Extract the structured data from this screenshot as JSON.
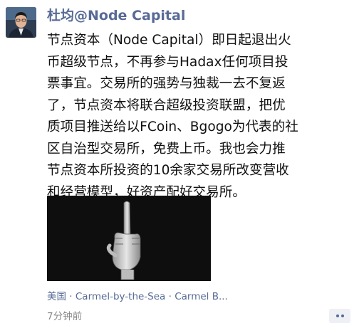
{
  "post": {
    "author": "杜均@Node Capital",
    "text_lines": [
      "节点资本（Node Capital）即日起退出火",
      "币超级节点，不再参与Hadax任何项目投",
      "票事宜。交易所的强势与独裁一去不复返",
      "了，节点资本将联合超级投资联盟，把优",
      "质项目推送给以FCoin、Bgogo为代表的社",
      "区自治型交易所，免费上币。我也会力推",
      "节点资本所投资的10余家交易所改变营收",
      "和经营模型，好资产配好交易所。"
    ],
    "location": "美国 · Carmel-by-the-Sea · Carmel B...",
    "time": "7分钟前"
  },
  "icons": {
    "avatar": "profile-photo",
    "image": "middle-finger-hand",
    "more": "more-dots-icon"
  },
  "colors": {
    "link": "#576b95",
    "text": "#111111",
    "muted": "#888888",
    "image_bg": "#0e0e0e"
  }
}
